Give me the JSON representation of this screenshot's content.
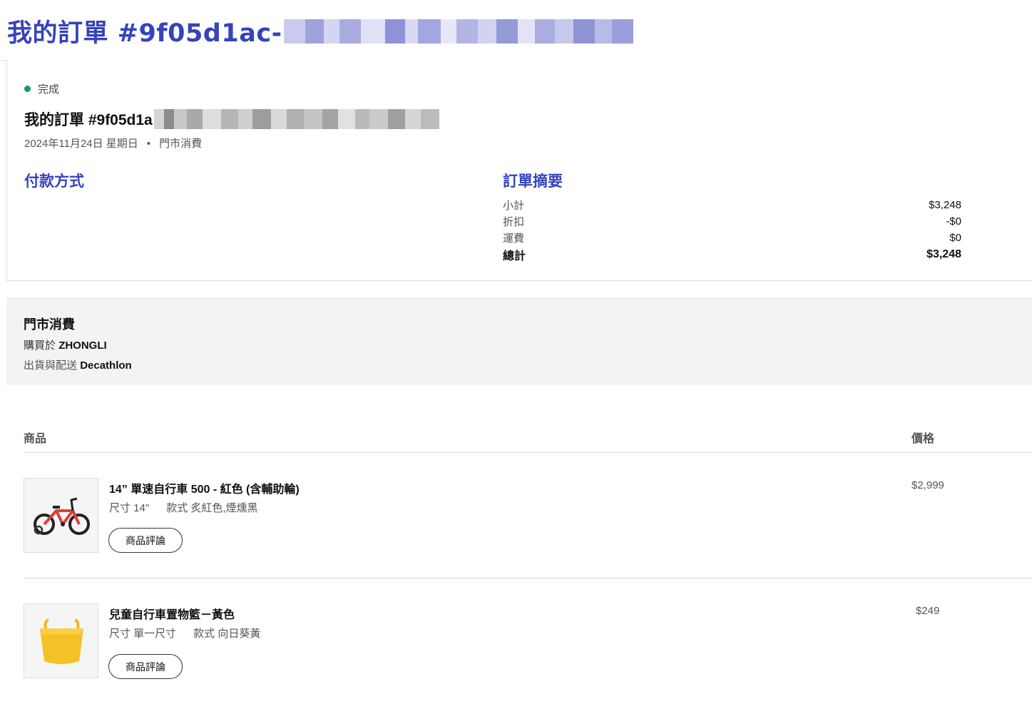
{
  "page": {
    "title": "我的訂單 #9f05d1ac-"
  },
  "order": {
    "status": "完成",
    "status_color": "#159e58",
    "heading": "我的訂單 #9f05d1a",
    "date": "2024年11月24日 星期日",
    "separator": "•",
    "channel": "門市消費"
  },
  "payment": {
    "title": "付款方式"
  },
  "summary": {
    "title": "訂單摘要",
    "rows": [
      {
        "label": "小計",
        "value": "$3,248"
      },
      {
        "label": "折扣",
        "value": "-$0"
      },
      {
        "label": "運費",
        "value": "$0"
      }
    ],
    "total": {
      "label": "總計",
      "value": "$3,248"
    }
  },
  "store": {
    "title": "門市消費",
    "purchased_prefix": "購買於",
    "purchased_store": "ZHONGLI",
    "shipping_prefix": "出貨與配送",
    "shipping_by": "Decathlon"
  },
  "items_table": {
    "col_product": "商品",
    "col_price": "價格",
    "items": [
      {
        "name": "14” 單速自行車 500 - 紅色 (含輔助輪)",
        "size": "尺寸 14\"",
        "style": "款式 炙紅色,煙燻黑",
        "price": "$2,999",
        "review_label": "商品評論",
        "icon": "kids-bicycle-image"
      },
      {
        "name": "兒童自行車置物籃－黃色",
        "size": "尺寸 單一尺寸",
        "style": "款式 向日葵黃",
        "price": "$249",
        "review_label": "商品評論",
        "icon": "yellow-basket-image"
      }
    ]
  },
  "colors": {
    "accent": "#3643ba",
    "success": "#159e58"
  }
}
